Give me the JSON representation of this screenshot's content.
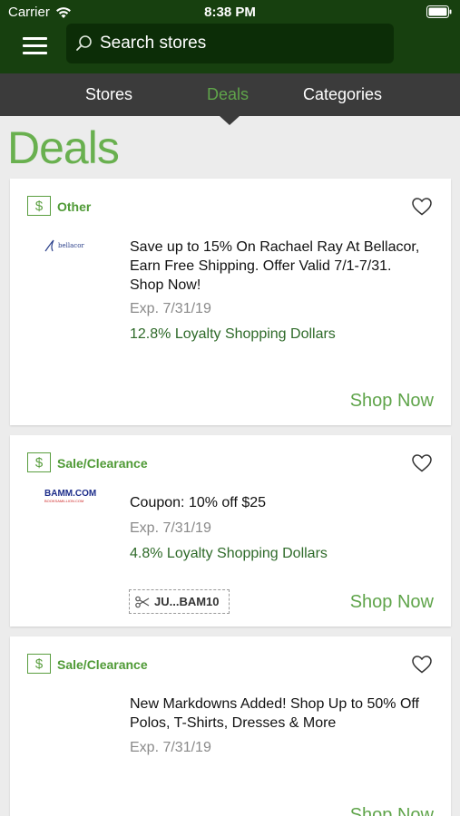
{
  "status_bar": {
    "carrier": "Carrier",
    "time": "8:38 PM",
    "icons": [
      "wifi-icon",
      "battery-icon"
    ]
  },
  "header": {
    "search_placeholder": "Search stores",
    "colors": {
      "header_bg": "#17400f",
      "search_bg": "#0c2d07"
    }
  },
  "tabs": [
    {
      "label": "Stores",
      "active": false
    },
    {
      "label": "Deals",
      "active": true
    },
    {
      "label": "Categories",
      "active": false
    }
  ],
  "page_title": "Deals",
  "deals": [
    {
      "category": "Other",
      "store": "bellacor",
      "description": "Save up to 15% On Rachael Ray At Bellacor, Earn Free Shipping. Offer Valid 7/1-7/31. Shop Now!",
      "expiration": "Exp. 7/31/19",
      "loyalty": "12.8% Loyalty Shopping Dollars",
      "action": "Shop Now"
    },
    {
      "category": "Sale/Clearance",
      "store": "BAMM.COM",
      "store_sub": "BOOKSAMILLION.COM",
      "description": "Coupon: 10% off $25",
      "expiration": "Exp. 7/31/19",
      "loyalty": "4.8% Loyalty Shopping Dollars",
      "coupon_code": "JU...BAM10",
      "action": "Shop Now"
    },
    {
      "category": "Sale/Clearance",
      "description": "New Markdowns Added! Shop Up to 50% Off Polos, T-Shirts, Dresses & More",
      "expiration": "Exp. 7/31/19",
      "action": "Shop Now"
    }
  ],
  "colors": {
    "accent_green": "#5fa44a",
    "loyalty_green": "#2e6a29",
    "tab_bar": "#3b3b3b"
  }
}
